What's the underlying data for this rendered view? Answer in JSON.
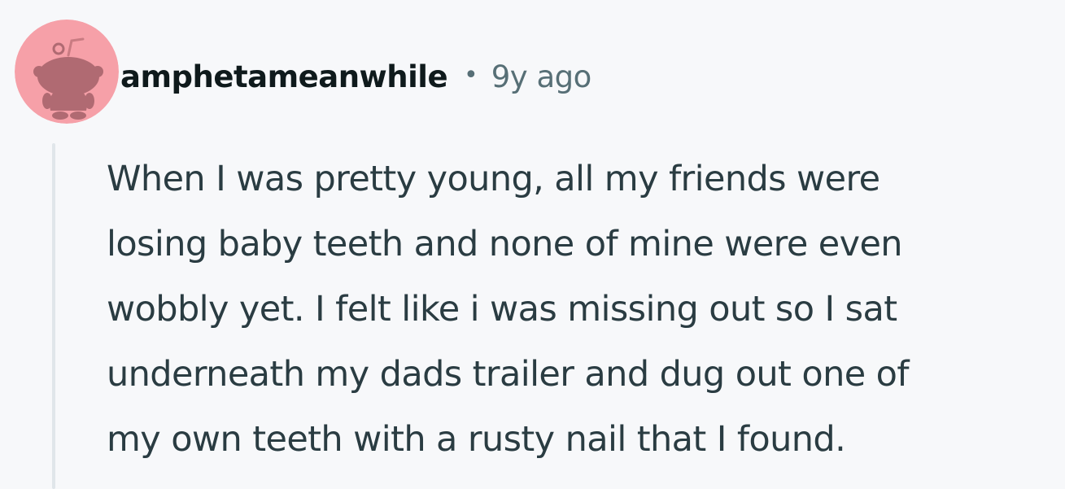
{
  "comment": {
    "author": "amphetameanwhile",
    "separator": "•",
    "age": "9y ago",
    "avatar_icon": "snoo-avatar-icon",
    "avatar_color": "#f6a0a8",
    "body_lines": [
      "When I was pretty young, all my friends were",
      "losing baby teeth and none of mine were even",
      "wobbly yet. I felt like i was missing out so I sat",
      "underneath my dads trailer and dug out one of",
      "my own teeth with a rusty nail that I found."
    ]
  },
  "colors": {
    "background": "#f7f8fa",
    "username": "#0f1a1c",
    "meta": "#576f76",
    "body": "#2a3c42",
    "thread_line": "#e0e6ea"
  }
}
